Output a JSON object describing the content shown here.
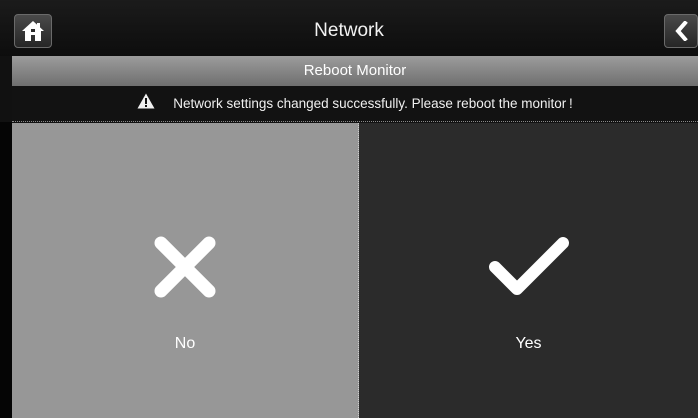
{
  "header": {
    "title": "Network",
    "home_icon": "home-icon",
    "back_icon": "chevron-left-icon"
  },
  "subheader": {
    "title": "Reboot Monitor"
  },
  "message": {
    "icon": "warning-icon",
    "text": "Network settings changed successfully. Please reboot the monitor !"
  },
  "choices": {
    "no": {
      "label": "No",
      "icon": "close-icon"
    },
    "yes": {
      "label": "Yes",
      "icon": "checkmark-icon"
    }
  },
  "colors": {
    "no_panel": "#979797",
    "yes_panel": "#2b2b2b",
    "subheader": "#8a8a8a"
  }
}
